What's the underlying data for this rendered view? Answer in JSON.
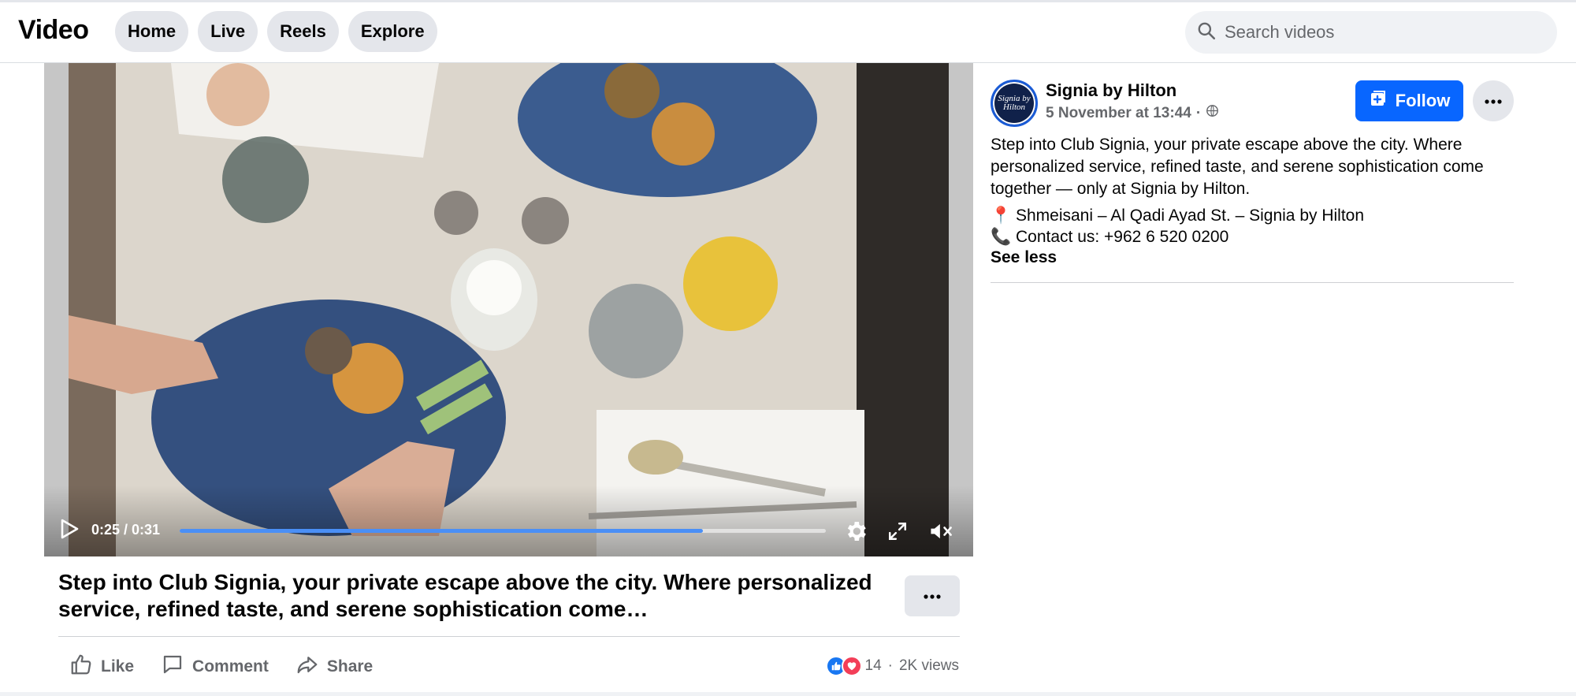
{
  "app": {
    "brand": "Video"
  },
  "nav": {
    "items": [
      "Home",
      "Live",
      "Reels",
      "Explore"
    ]
  },
  "search": {
    "placeholder": "Search videos"
  },
  "player": {
    "current_time": "0:25",
    "duration": "0:31",
    "time_label": "0:25 / 0:31",
    "progress_fraction": 0.81,
    "icons": [
      "play-icon",
      "settings-icon",
      "fullscreen-icon",
      "muted-icon"
    ]
  },
  "post": {
    "caption": "Step into Club Signia, your private escape above the city. Where personalized service, refined taste, and serene sophistication come…",
    "actions": {
      "like": "Like",
      "comment": "Comment",
      "share": "Share"
    },
    "reactions_count": "14",
    "views": "2K views",
    "separator": "·"
  },
  "page": {
    "name": "Signia by Hilton",
    "avatar_text": "Signia by Hilton",
    "date": "5 November at 13:44",
    "audience_icon": "globe-icon",
    "follow_label": "Follow",
    "description": "Step into Club Signia, your private escape above the city. Where personalized service, refined taste, and serene sophistication come together — only at Signia by Hilton.",
    "location_line": "📍 Shmeisani – Al Qadi Ayad St. – Signia by Hilton",
    "contact_line": "📞 Contact us: +962 6 520 0200",
    "see_less": "See less"
  },
  "colors": {
    "accent": "#0866ff",
    "progress": "#4a8ff6",
    "like": "#1877f2",
    "love": "#f33e58"
  }
}
